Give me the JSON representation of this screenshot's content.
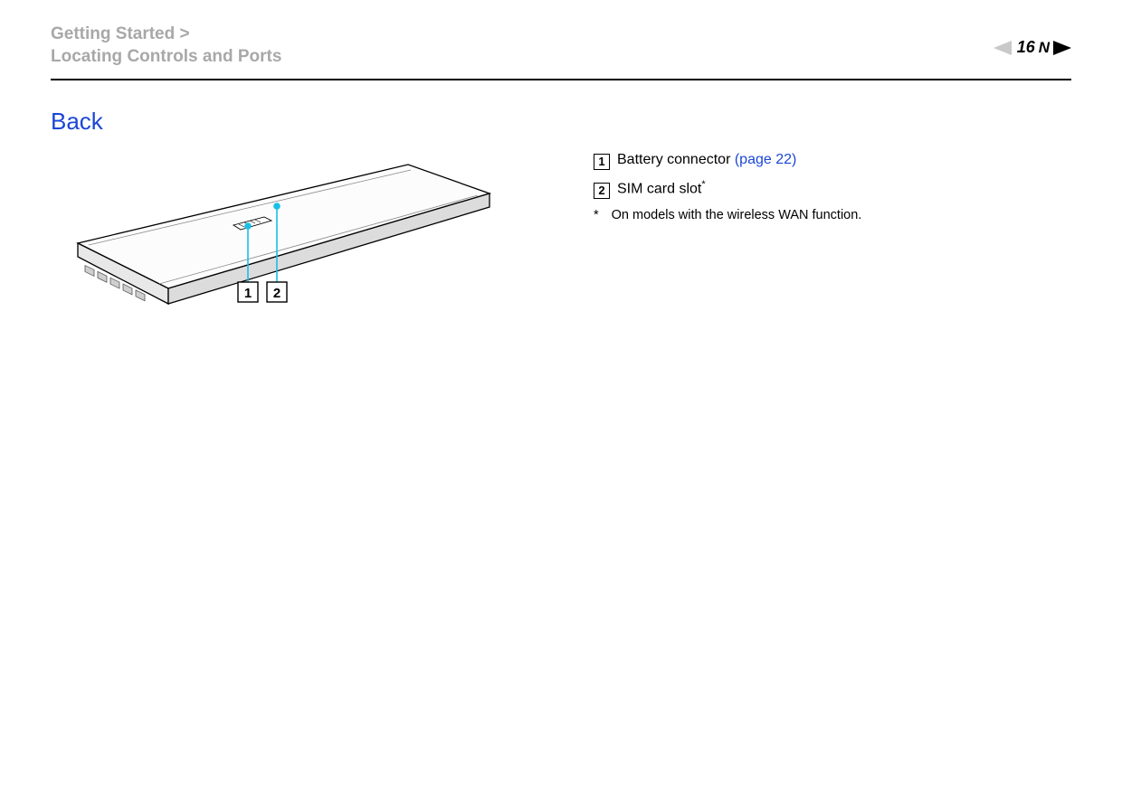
{
  "header": {
    "breadcrumb_section": "Getting Started",
    "breadcrumb_separator": ">",
    "breadcrumb_page": "Locating Controls and Ports",
    "page_number": "16",
    "n_letter": "N"
  },
  "section": {
    "title": "Back"
  },
  "diagram": {
    "callout_1": "1",
    "callout_2": "2"
  },
  "legend": {
    "item1": {
      "num": "1",
      "text": "Battery connector ",
      "link": "(page 22)"
    },
    "item2": {
      "num": "2",
      "text": "SIM card slot",
      "sup": "*"
    },
    "footnote": {
      "mark": "*",
      "text": "On models with the wireless WAN function."
    }
  }
}
